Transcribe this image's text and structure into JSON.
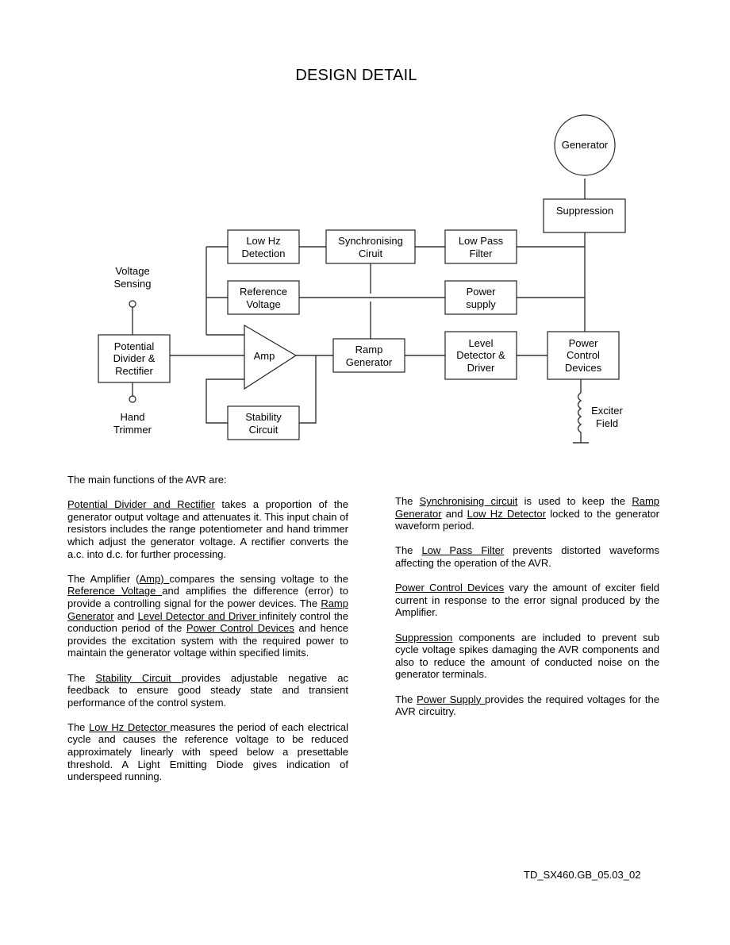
{
  "page": {
    "title": "DESIGN DETAIL",
    "footer_code": "TD_SX460.GB_05.03_02"
  },
  "diagram": {
    "generator": "Generator",
    "suppression": "Suppression",
    "low_hz_detection": [
      "Low Hz",
      "Detection"
    ],
    "synchronising_circuit": [
      "Synchronising",
      "Ciruit"
    ],
    "low_pass_filter": [
      "Low Pass",
      "Filter"
    ],
    "reference_voltage": [
      "Reference",
      "Voltage"
    ],
    "power_supply": [
      "Power",
      "supply"
    ],
    "amp": "Amp",
    "ramp_generator": [
      "Ramp",
      "Generator"
    ],
    "level_detector_driver": [
      "Level",
      "Detector &",
      "Driver"
    ],
    "power_control_devices": [
      "Power",
      "Control",
      "Devices"
    ],
    "potential_divider_rectifier": [
      "Potential",
      "Divider &",
      "Rectifier"
    ],
    "stability_circuit": [
      "Stability",
      "Circuit"
    ],
    "voltage_sensing": [
      "Voltage",
      "Sensing"
    ],
    "hand_trimmer": [
      "Hand",
      "Trimmer"
    ],
    "exciter_field": [
      "Exciter",
      "Field"
    ]
  },
  "text": {
    "intro": "The main functions of the AVR are:",
    "pdr": {
      "link": "Potential Divider and Rectifier",
      "rest": " takes a proportion of the generator output voltage and attenuates it. This input chain of resistors includes the range potentiometer and hand trimmer which adjust the generator voltage. A rectifier converts the a.c. into d.c. for further processing."
    },
    "amp": {
      "t1": "The Amplifier (",
      "l1": "Amp) ",
      "t2": "compares the sensing voltage to the ",
      "l2": "Reference Voltage ",
      "t3": "and amplifies the difference (error) to provide a controlling signal for the power devices. The ",
      "l3": "Ramp Generator",
      "t4": " and ",
      "l4": "Level Detector and Driver ",
      "t5": "infinitely control the conduction period of the ",
      "l5": "Power Control Devices",
      "t6": " and hence provides the excitation system with the required power to maintain the generator voltage within specified limits."
    },
    "stability": {
      "t1": "The ",
      "link": "Stability Circuit ",
      "rest": " provides adjustable negative ac feedback to ensure good steady state and transient performance of the control system."
    },
    "lowhz": {
      "t1": "The ",
      "link": "Low Hz Detector ",
      "rest": "measures the period of each electrical cycle and causes the reference voltage to be reduced approximately linearly with speed below a presettable threshold. A Light Emitting Diode gives indication of underspeed running."
    },
    "sync": {
      "t1": "The ",
      "l1": "Synchronising circuit",
      "t2": " is used to keep the ",
      "l2": "Ramp Generator",
      "t3": " and ",
      "l3": "Low Hz Detector",
      "t4": " locked to the generator waveform period."
    },
    "lpf": {
      "t1": "The ",
      "link": "Low Pass Filter",
      "rest": " prevents distorted waveforms affecting the operation of the AVR."
    },
    "pcd": {
      "link": "Power Control Devices",
      "rest": " vary the amount of exciter field current in response to the error signal produced by the Amplifier."
    },
    "supp": {
      "link": "Suppression",
      "rest": " components are included to prevent sub cycle voltage spikes damaging the AVR components and also to reduce the amount of conducted noise on the generator terminals."
    },
    "psu": {
      "t1": "The ",
      "link": "Power Supply ",
      "rest": " provides the required voltages for the AVR circuitry."
    }
  }
}
